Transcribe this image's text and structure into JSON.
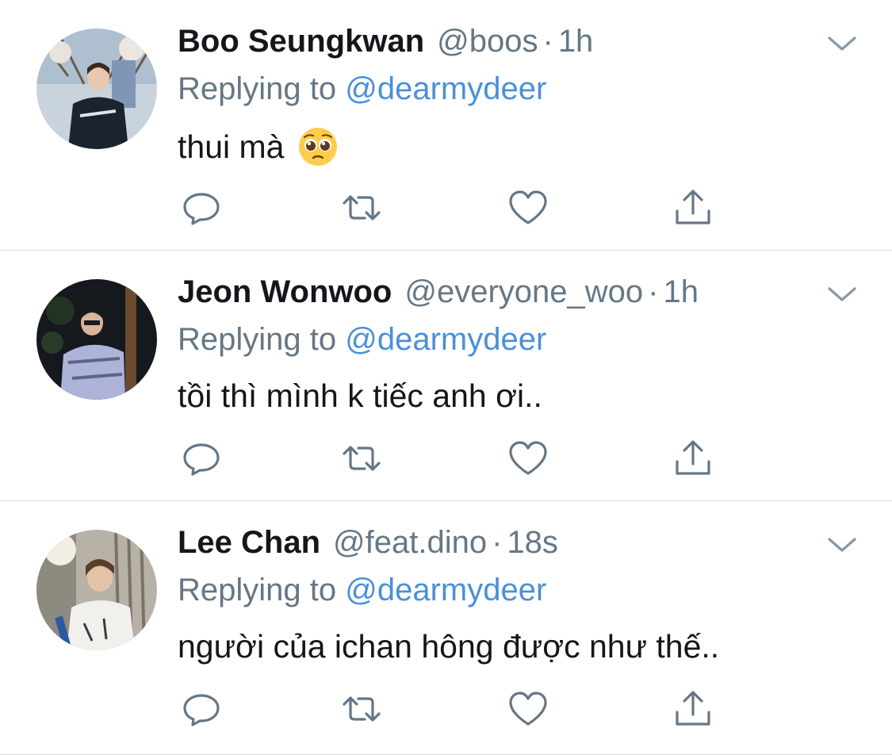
{
  "tweets": [
    {
      "name": "Boo Seungkwan",
      "handle": "@boos",
      "dot": "·",
      "time": "1h",
      "replying_prefix": "Replying to",
      "replying_to": "@dearmydeer",
      "text": "thui mà",
      "emoji": "pleading-face"
    },
    {
      "name": "Jeon Wonwoo",
      "handle": "@everyone_woo",
      "dot": "·",
      "time": "1h",
      "replying_prefix": "Replying to",
      "replying_to": "@dearmydeer",
      "text": "tồi thì mình k tiếc anh ơi.."
    },
    {
      "name": "Lee Chan",
      "handle": "@feat.dino",
      "dot": "·",
      "time": "18s",
      "replying_prefix": "Replying to",
      "replying_to": "@dearmydeer",
      "text": "người của ichan hông được như thế.."
    }
  ],
  "icons": [
    "reply-icon",
    "retweet-icon",
    "like-icon",
    "share-icon",
    "chevron-down-icon"
  ],
  "colors": {
    "text": "#14171a",
    "secondary": "#657786",
    "mention": "#4a90d9",
    "divider": "#d8dde1"
  }
}
